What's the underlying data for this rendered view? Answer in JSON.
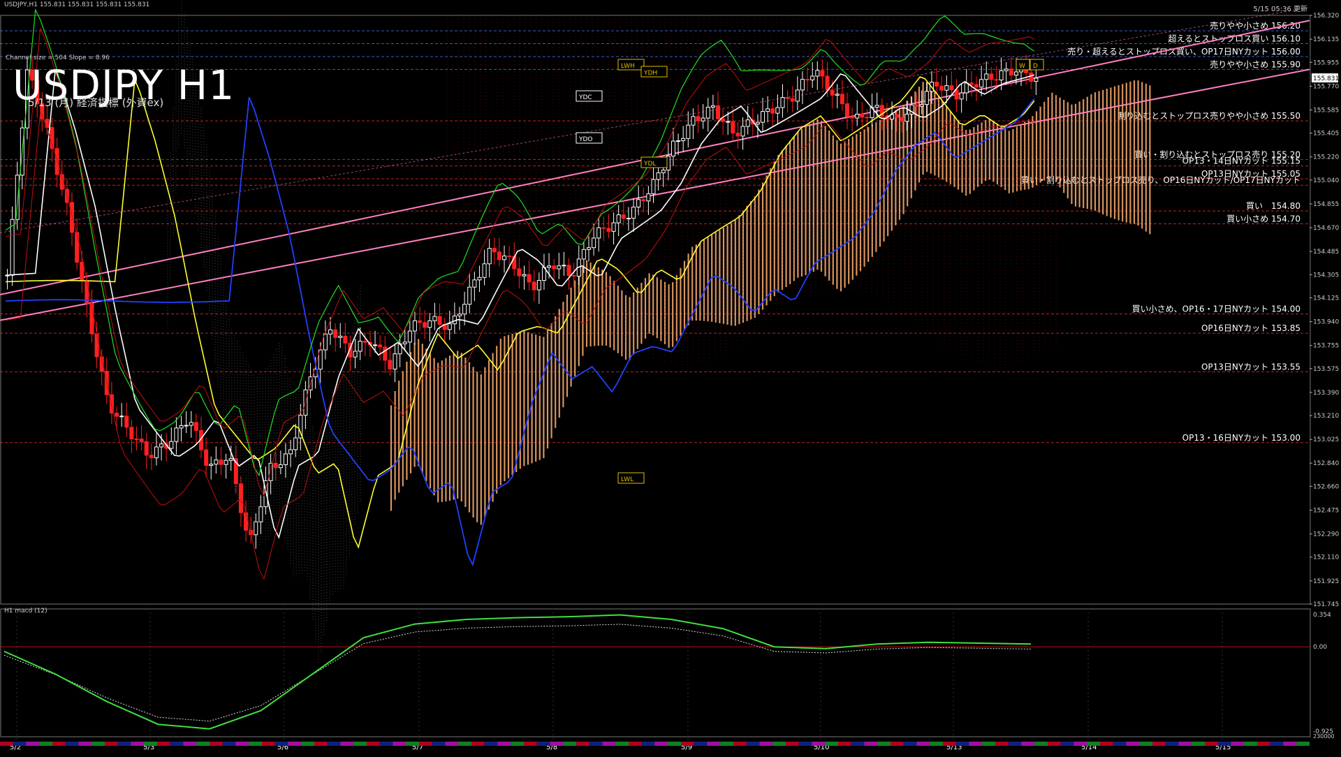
{
  "header": {
    "symbol_info": "USDJPY,H1  155.831 155.831 155.831 155.831",
    "channel_info": "Channel size = 504 Slope = 8.96",
    "updated": "5/15 05:36 更新"
  },
  "title": "USDJPY H1",
  "subtitle": "5/13 (月) 経済指標 (外資ex)",
  "colors": {
    "background": "#000000",
    "grid": "#3a3a3a",
    "bull": "#ffffff",
    "bear": "#ff2020",
    "channel": "#ff80c0",
    "sma_white": "#ffffff",
    "sma_yellow": "#ffff30",
    "sma_blue": "#2040ff",
    "ichimoku_green": "#20e020",
    "cloud": "#ffb070"
  },
  "chart_data": {
    "type": "candlestick",
    "timeframe": "H1",
    "ylim": [
      151.745,
      156.32
    ],
    "y_ticks": [
      "156.320",
      "156.135",
      "155.955",
      "155.770",
      "155.585",
      "155.405",
      "155.220",
      "155.040",
      "154.855",
      "154.670",
      "154.485",
      "154.305",
      "154.125",
      "153.940",
      "153.755",
      "153.575",
      "153.390",
      "153.210",
      "153.025",
      "152.840",
      "152.660",
      "152.475",
      "152.290",
      "152.110",
      "151.925",
      "151.745"
    ],
    "current_price": "155.831",
    "x_labels": [
      "5/2",
      "5/3",
      "5/6",
      "5/7",
      "5/8",
      "5/9",
      "5/10",
      "5/13",
      "5/14",
      "5/15"
    ],
    "close_path": [
      154.3,
      155.9,
      155.4,
      154.8,
      154.0,
      153.3,
      153.1,
      152.9,
      153.0,
      153.2,
      152.8,
      152.9,
      152.2,
      152.8,
      152.9,
      153.5,
      153.9,
      153.7,
      153.8,
      153.6,
      153.9,
      153.95,
      153.9,
      154.2,
      154.5,
      154.4,
      154.2,
      154.4,
      154.3,
      154.6,
      154.7,
      154.8,
      155.0,
      155.3,
      155.5,
      155.6,
      155.4,
      155.5,
      155.6,
      155.7,
      155.9,
      155.7,
      155.5,
      155.6,
      155.5,
      155.6,
      155.8,
      155.7,
      155.8,
      155.85,
      155.9,
      155.83
    ],
    "levels": [
      {
        "label": "売りやや小さめ 156.20",
        "price": 156.2,
        "color": "#5a7aff"
      },
      {
        "label": "超えるとストップロス買い 156.10",
        "price": 156.1,
        "color": "#5a7aff"
      },
      {
        "label": "売り・超えるとストップロス買い、OP17日NYカット 156.00",
        "price": 156.0,
        "color": "#5a7aff"
      },
      {
        "label": "売りやや小さめ 155.90",
        "price": 155.9,
        "color": "#5a7aff"
      },
      {
        "label": "割り込むとストップロス売りやや小さめ 155.50",
        "price": 155.5,
        "color": "#ff3030"
      },
      {
        "label": "買い・割り込むとストップロス売り 155.20",
        "price": 155.2,
        "color": "#ff3030"
      },
      {
        "label": "OP13・14日NYカット 155.15",
        "price": 155.15,
        "color": "#ff3030"
      },
      {
        "label": "OP13日NYカット 155.05",
        "price": 155.05,
        "color": "#ff3030"
      },
      {
        "label": "買い・割り込むとストップロス売り、OP16日NYカット/OP17日NYカット",
        "price": 155.0,
        "color": "#ff3030"
      },
      {
        "label": "買い　154.80",
        "price": 154.8,
        "color": "#ff3030"
      },
      {
        "label": "買い小さめ 154.70",
        "price": 154.7,
        "color": "#ff3030"
      },
      {
        "label": "買い小さめ、OP16・17日NYカット 154.00",
        "price": 154.0,
        "color": "#ff3030"
      },
      {
        "label": "OP16日NYカット 153.85",
        "price": 153.85,
        "color": "#ff3030"
      },
      {
        "label": "OP13日NYカット 153.55",
        "price": 153.55,
        "color": "#ff3030"
      },
      {
        "label": "OP13・16日NYカット 153.00",
        "price": 153.0,
        "color": "#ff3030"
      }
    ],
    "markers": [
      "LWH",
      "YDH",
      "YDC",
      "YDO",
      "YDL",
      "LWL",
      "W",
      "D"
    ],
    "macd": {
      "label": "H1  macd (12)",
      "y_ticks": [
        "0.354",
        "0.00",
        "-0.925"
      ],
      "path": [
        -0.05,
        -0.3,
        -0.6,
        -0.85,
        -0.9,
        -0.7,
        -0.3,
        0.1,
        0.25,
        0.3,
        0.32,
        0.33,
        0.35,
        0.3,
        0.2,
        0.0,
        -0.02,
        0.03,
        0.05,
        0.04,
        0.03
      ]
    },
    "volume_label": "230000"
  }
}
